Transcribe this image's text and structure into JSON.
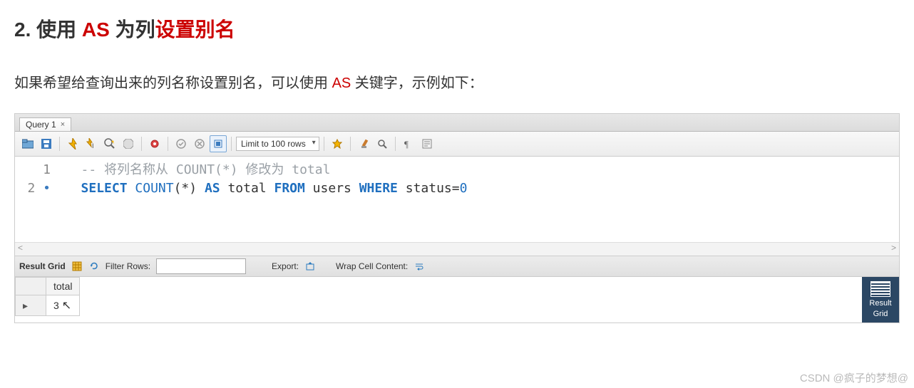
{
  "heading": {
    "pre": "2. 使用 ",
    "kw": "AS",
    "mid": " 为列",
    "red2": "设置别名"
  },
  "intro": {
    "pre": "如果希望给查询出来的列名称设置别名，可以使用 ",
    "kw": "AS",
    "post": " 关键字，示例如下："
  },
  "tab": {
    "label": "Query 1"
  },
  "toolbar": {
    "limit": "Limit to 100 rows",
    "icons": [
      "folder",
      "save",
      "bolt",
      "bolt-cursor",
      "zoom",
      "stop",
      "pin",
      "ok",
      "cancel",
      "wrap",
      "star",
      "brush",
      "search",
      "para",
      "form"
    ]
  },
  "code": {
    "lines": [
      {
        "n": "1",
        "bullet": false,
        "seg": [
          {
            "t": "   -- 将列名称从 COUNT(*) 修改为 total",
            "c": "c-comm"
          }
        ]
      },
      {
        "n": "2",
        "bullet": true,
        "seg": [
          {
            "t": "   ",
            "c": "c-plain"
          },
          {
            "t": "SELECT",
            "c": "c-kw"
          },
          {
            "t": " ",
            "c": "c-plain"
          },
          {
            "t": "COUNT",
            "c": "c-fn"
          },
          {
            "t": "(*) ",
            "c": "c-plain"
          },
          {
            "t": "AS",
            "c": "c-kw"
          },
          {
            "t": " total ",
            "c": "c-plain"
          },
          {
            "t": "FROM",
            "c": "c-kw"
          },
          {
            "t": " users ",
            "c": "c-plain"
          },
          {
            "t": "WHERE",
            "c": "c-kw"
          },
          {
            "t": " status=",
            "c": "c-plain"
          },
          {
            "t": "0",
            "c": "c-num"
          }
        ]
      }
    ]
  },
  "resultbar": {
    "label": "Result Grid",
    "filter": "Filter Rows:",
    "filter_value": "",
    "export": "Export:",
    "wrap": "Wrap Cell Content:"
  },
  "grid": {
    "columns": [
      "total"
    ],
    "rows": [
      [
        "3"
      ]
    ]
  },
  "side": {
    "label1": "Result",
    "label2": "Grid"
  },
  "watermark": "CSDN @疯子的梦想@"
}
